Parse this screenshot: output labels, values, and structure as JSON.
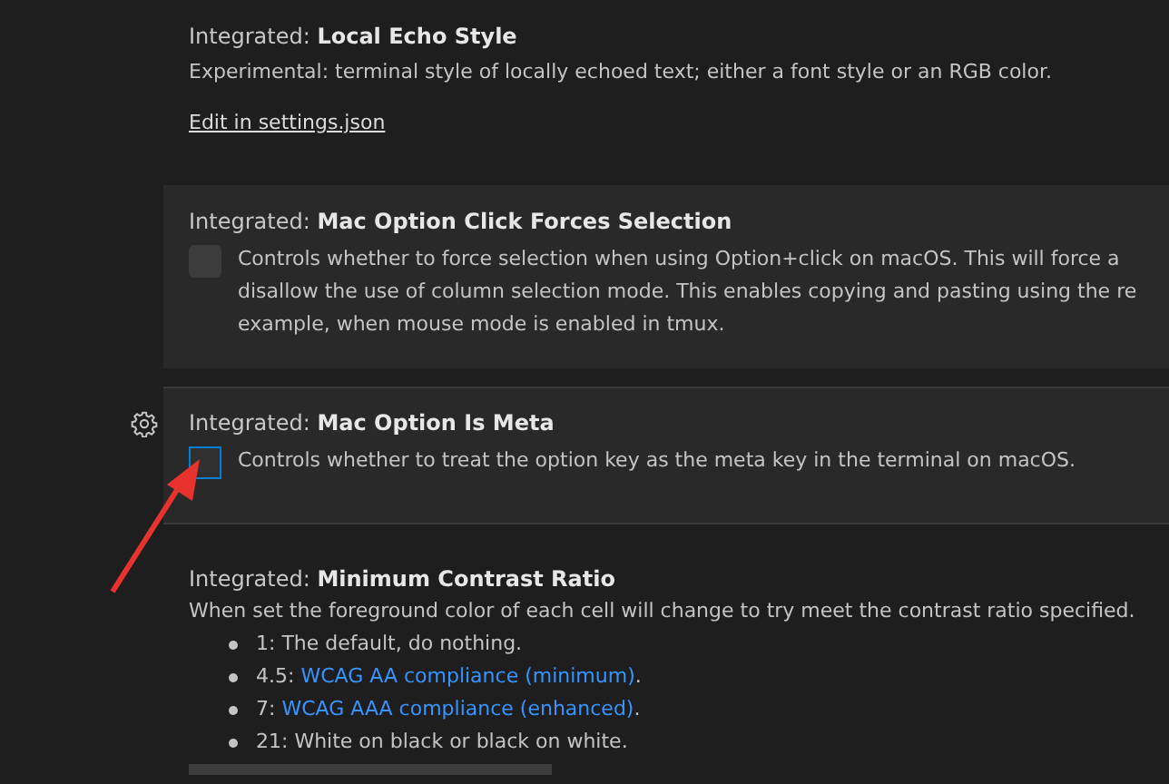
{
  "settings": [
    {
      "kind": "text",
      "category": "Integrated:",
      "title": "Local Echo Style",
      "hovered": false,
      "focused": false,
      "description": [
        "Experimental: terminal style of locally echoed text; either a font style or an RGB color."
      ],
      "link": "Edit in settings.json"
    },
    {
      "kind": "checkbox",
      "category": "Integrated:",
      "title": "Mac Option Click Forces Selection",
      "hovered": true,
      "focused": false,
      "checked": false,
      "description": [
        "Controls whether to force selection when using Option+click on macOS. This will force a",
        "disallow the use of column selection mode. This enables copying and pasting using the re",
        "example, when mouse mode is enabled in tmux."
      ]
    },
    {
      "kind": "checkbox",
      "category": "Integrated:",
      "title": "Mac Option Is Meta",
      "hovered": true,
      "focused": true,
      "checked": false,
      "description": [
        "Controls whether to treat the option key as the meta key in the terminal on macOS."
      ]
    },
    {
      "kind": "list",
      "category": "Integrated:",
      "title": "Minimum Contrast Ratio",
      "hovered": false,
      "focused": false,
      "number_field": true,
      "description": [
        "When set the foreground color of each cell will change to try meet the contrast ratio specified."
      ],
      "bullets": [
        {
          "text": "1: The default, do nothing."
        },
        {
          "text": "4.5:",
          "link": "WCAG AA compliance (minimum)",
          "after": "."
        },
        {
          "text": "7:",
          "link": "WCAG AAA compliance (enhanced)",
          "after": "."
        },
        {
          "text": "21: White on black or black on white."
        }
      ]
    }
  ],
  "annotation": {
    "kind": "arrow"
  }
}
